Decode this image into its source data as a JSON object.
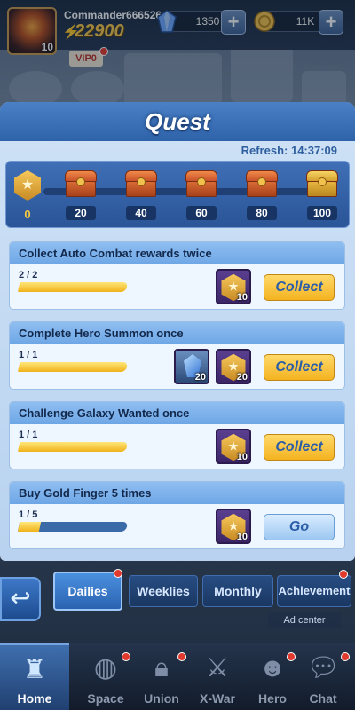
{
  "header": {
    "commander_name": "Commander666526",
    "avatar_level": "10",
    "power": "22900",
    "crystals": "1350",
    "gold": "11K",
    "vip": "VIP0"
  },
  "quest_panel": {
    "title": "Quest",
    "refresh": "Refresh: 14:37:09",
    "current_points": "0",
    "milestones": [
      {
        "label": "20",
        "type": "chest"
      },
      {
        "label": "40",
        "type": "chest"
      },
      {
        "label": "60",
        "type": "chest"
      },
      {
        "label": "80",
        "type": "chest"
      },
      {
        "label": "100",
        "type": "gold-chest"
      }
    ],
    "quests": [
      {
        "title": "Collect Auto Combat rewards twice",
        "progress": "2 / 2",
        "progress_fraction": 1.0,
        "rewards": [
          {
            "type": "quest-medal",
            "count": "10"
          }
        ],
        "action": "Collect"
      },
      {
        "title": "Complete Hero Summon once",
        "progress": "1 / 1",
        "progress_fraction": 1.0,
        "rewards": [
          {
            "type": "crystal",
            "count": "20"
          },
          {
            "type": "quest-medal",
            "count": "20"
          }
        ],
        "action": "Collect"
      },
      {
        "title": "Challenge Galaxy Wanted once",
        "progress": "1 / 1",
        "progress_fraction": 1.0,
        "rewards": [
          {
            "type": "quest-medal",
            "count": "10"
          }
        ],
        "action": "Collect"
      },
      {
        "title": "Buy Gold Finger 5 times",
        "progress": "1 / 5",
        "progress_fraction": 0.2,
        "rewards": [
          {
            "type": "quest-medal",
            "count": "10"
          }
        ],
        "action": "Go"
      }
    ]
  },
  "tabs": [
    "Dailies",
    "Weeklies",
    "Monthly",
    "Achievement"
  ],
  "ad_center": "Ad center",
  "bottom_nav": [
    "Home",
    "Space",
    "Union",
    "X-War",
    "Hero",
    "Chat"
  ],
  "colors": {
    "accent": "#2f63a9",
    "collect_button": "#f4b321",
    "progress_fill": "#f0b21a",
    "notification": "#e03a2e"
  }
}
